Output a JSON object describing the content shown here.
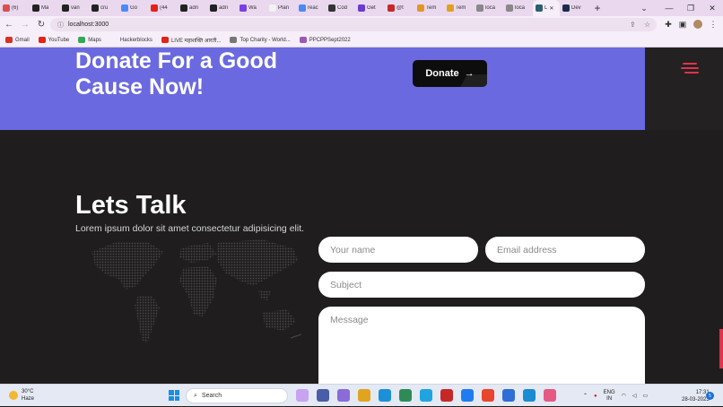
{
  "browser": {
    "tabs": [
      {
        "label": "(6)",
        "fav": "#d94f4f"
      },
      {
        "label": "Ma",
        "fav": "#222"
      },
      {
        "label": "van",
        "fav": "#222"
      },
      {
        "label": "cru",
        "fav": "#222"
      },
      {
        "label": "Go",
        "fav": "#4a8af4"
      },
      {
        "label": "(44",
        "fav": "#e62117"
      },
      {
        "label": "adri",
        "fav": "#222"
      },
      {
        "label": "adri",
        "fav": "#222"
      },
      {
        "label": "Wa",
        "fav": "#7b3fe4"
      },
      {
        "label": "Plan",
        "fav": "#f2f2f2"
      },
      {
        "label": "reac",
        "fav": "#4a8af4"
      },
      {
        "label": "Cod",
        "fav": "#333"
      },
      {
        "label": "Get",
        "fav": "#6a3bd1"
      },
      {
        "label": "@t",
        "fav": "#c62828"
      },
      {
        "label": "Tem",
        "fav": "#e09820"
      },
      {
        "label": "Tem",
        "fav": "#e0a020"
      },
      {
        "label": "loca",
        "fav": "#888"
      },
      {
        "label": "loca",
        "fav": "#888"
      },
      {
        "label": "L",
        "fav": "#2f5d73",
        "active": true
      },
      {
        "label": "Dev",
        "fav": "#1b2a49"
      }
    ],
    "new_tab": "+",
    "url": "localhost:3000",
    "window_controls": {
      "dropdown": "⌄",
      "minimize": "—",
      "restore": "❐",
      "close": "✕"
    }
  },
  "bookmarks": [
    {
      "label": "Gmail",
      "color": "#d93025"
    },
    {
      "label": "YouTube",
      "color": "#e62117"
    },
    {
      "label": "Maps",
      "color": "#34a853"
    },
    {
      "label": "Hackerblocks",
      "color": "#f6eef8"
    },
    {
      "label": "LIVE महाशक्ति आरती...",
      "color": "#e62117"
    },
    {
      "label": "Top Charity - World...",
      "color": "#777"
    },
    {
      "label": "PPCPPSept2022",
      "color": "#9b59b6"
    }
  ],
  "hero": {
    "title": "Donate For a Good Cause Now!",
    "donate_label": "Donate",
    "donate_arrow": "→"
  },
  "contact": {
    "title": "Lets Talk",
    "subtitle": "Lorem ipsum dolor sit amet consectetur adipisicing elit.",
    "name_placeholder": "Your name",
    "email_placeholder": "Email address",
    "subject_placeholder": "Subject",
    "message_placeholder": "Message"
  },
  "taskbar": {
    "weather_temp": "30°C",
    "weather_desc": "Haze",
    "search_label": "Search",
    "lang_top": "ENG",
    "lang_bottom": "IN",
    "time": "17:31",
    "date": "28-03-2023",
    "notifications": "5",
    "apps": [
      "#c7a3f0",
      "#4a5da8",
      "#8a6bd8",
      "#e0a420",
      "#1c8fd9",
      "#2e8b57",
      "#1fa4e0",
      "#c62828",
      "#1f7cf0",
      "#e8462d",
      "#2d6fd6",
      "#1b8bd3",
      "#e45a84"
    ]
  }
}
